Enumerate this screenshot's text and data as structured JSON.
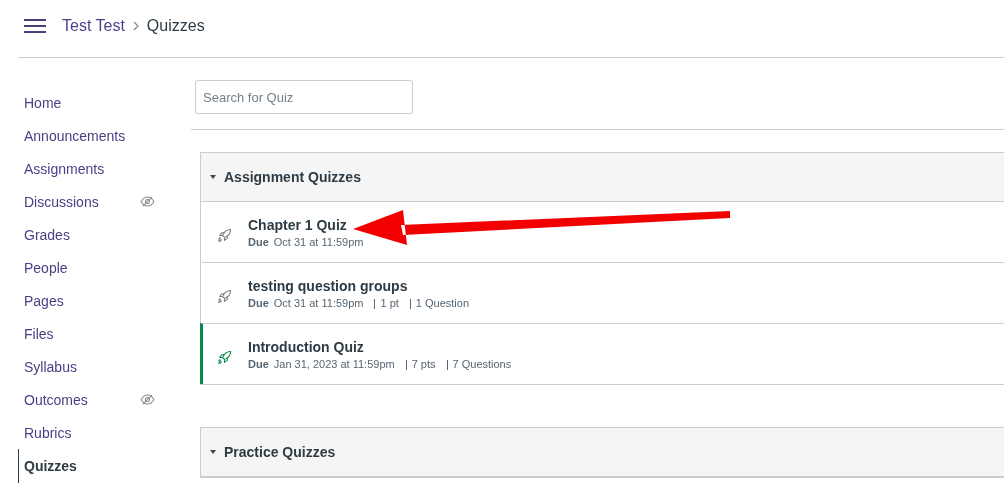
{
  "breadcrumb": [
    {
      "label": "Test Test"
    },
    {
      "label": "Quizzes"
    }
  ],
  "sidebar": {
    "items": [
      {
        "label": "Home",
        "selected": false,
        "hidden": false
      },
      {
        "label": "Announcements",
        "selected": false,
        "hidden": false
      },
      {
        "label": "Assignments",
        "selected": false,
        "hidden": false
      },
      {
        "label": "Discussions",
        "selected": false,
        "hidden": true
      },
      {
        "label": "Grades",
        "selected": false,
        "hidden": false
      },
      {
        "label": "People",
        "selected": false,
        "hidden": false
      },
      {
        "label": "Pages",
        "selected": false,
        "hidden": false
      },
      {
        "label": "Files",
        "selected": false,
        "hidden": false
      },
      {
        "label": "Syllabus",
        "selected": false,
        "hidden": false
      },
      {
        "label": "Outcomes",
        "selected": false,
        "hidden": true
      },
      {
        "label": "Rubrics",
        "selected": false,
        "hidden": false
      },
      {
        "label": "Quizzes",
        "selected": true,
        "hidden": false
      }
    ]
  },
  "search": {
    "placeholder": "Search for Quiz"
  },
  "groups": [
    {
      "title": "Assignment Quizzes",
      "expanded": true,
      "quizzes": [
        {
          "title": "Chapter 1 Quiz",
          "due_label": "Due",
          "due": "Oct 31 at 11:59pm",
          "published": false
        },
        {
          "title": "testing question groups",
          "due_label": "Due",
          "due": "Oct 31 at 11:59pm",
          "points": "1 pt",
          "questions": "1 Question",
          "published": false
        },
        {
          "title": "Introduction Quiz",
          "due_label": "Due",
          "due": "Jan 31, 2023 at 11:59pm",
          "points": "7 pts",
          "questions": "7 Questions",
          "published": true
        }
      ]
    },
    {
      "title": "Practice Quizzes",
      "expanded": true
    }
  ]
}
